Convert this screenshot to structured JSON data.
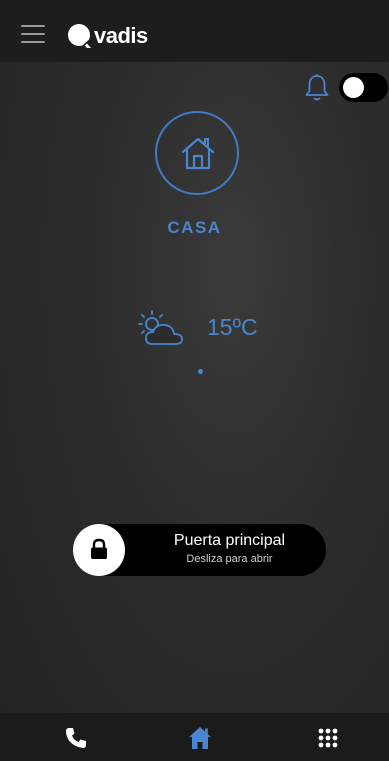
{
  "app": {
    "logo_text": "vadis"
  },
  "header": {
    "menu_icon": "hamburger-menu-icon",
    "notifications_icon": "bell-icon",
    "notifications_toggle_on": true
  },
  "place": {
    "icon": "home-icon",
    "label": "CASA"
  },
  "weather": {
    "icon": "partly-cloudy-icon",
    "temperature": "15ºC"
  },
  "pager": {
    "count": 1,
    "active": 1
  },
  "door": {
    "title": "Puerta principal",
    "subtitle": "Desliza para abrir",
    "icon": "lock-icon"
  },
  "bottom_nav": {
    "items": [
      {
        "icon": "phone-icon"
      },
      {
        "icon": "home-icon",
        "active": true
      },
      {
        "icon": "keypad-icon"
      }
    ]
  },
  "colors": {
    "accent": "#4a85cf",
    "background": "#2c2c2c",
    "bar": "#1d1d1d"
  }
}
